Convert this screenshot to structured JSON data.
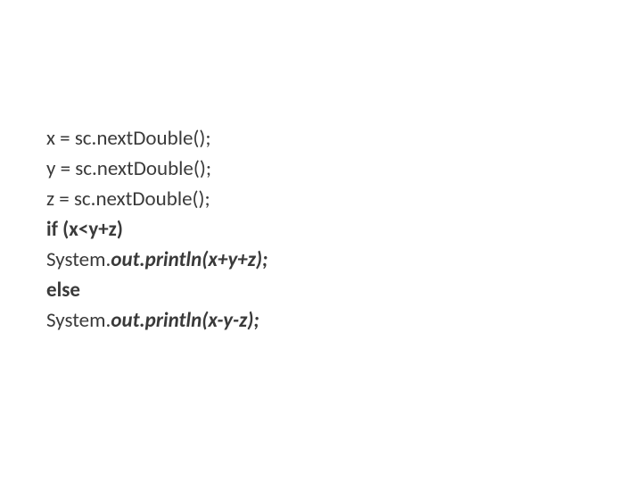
{
  "code": {
    "line1": "x = sc.nextDouble();",
    "line2": "y = sc.nextDouble();",
    "line3": "z = sc.nextDouble();",
    "line4": "if (x<y+z)",
    "line5_a": "System.",
    "line5_b": "out.println(x+y+z);",
    "line6": "else",
    "line7_a": "System.",
    "line7_b": "out.println(x-y-z);"
  }
}
